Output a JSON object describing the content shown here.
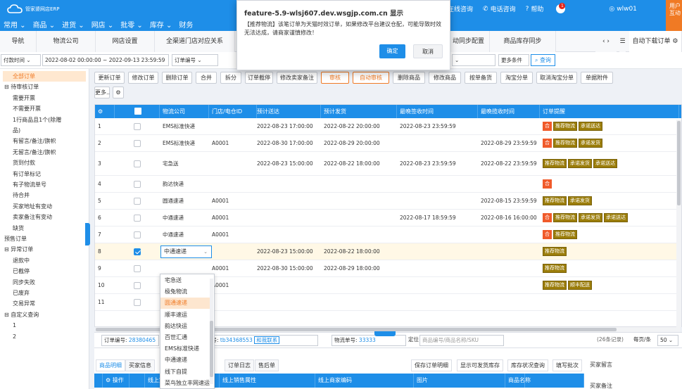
{
  "app": {
    "logo_text": "管家婆网店ERP",
    "corner_label": "用户互动",
    "user": "wlw01"
  },
  "topnav": [
    "常用",
    "商品",
    "进货",
    "网店",
    "批零",
    "库存",
    "财务"
  ],
  "rightnav": {
    "consult": "在线咨询",
    "phone": "电话咨询",
    "help": "帮助",
    "bell_count": "1"
  },
  "tabs": [
    "导航",
    "物流公司",
    "网店设置",
    "全渠道门店对应关系",
    "",
    "",
    "",
    "",
    "动同步配置",
    "商品库存同步"
  ],
  "tabs_right": "自动下载订单",
  "filter": {
    "time_type": "付款时间",
    "date_range": "2022-08-02 00:00:00 ~ 2022-09-13 23:59:59",
    "order_field": "订单编号",
    "more": "更多条件",
    "search": "查询"
  },
  "sidebar": [
    {
      "label": "全部订单",
      "level": 0
    },
    {
      "label": "⊟ 待审核订单",
      "level": 0
    },
    {
      "label": "需要开票",
      "level": 1
    },
    {
      "label": "不需要开票",
      "level": 1
    },
    {
      "label": "1行商品且1个(除赠",
      "level": 1
    },
    {
      "label": "品)",
      "level": 1
    },
    {
      "label": "有留言/备注/旗帜",
      "level": 1
    },
    {
      "label": "无留言/备注/旗帜",
      "level": 1
    },
    {
      "label": "货到付款",
      "level": 1
    },
    {
      "label": "有订单标记",
      "level": 1
    },
    {
      "label": "有子物流单号",
      "level": 1
    },
    {
      "label": "待合并",
      "level": 1
    },
    {
      "label": "买家地址有变动",
      "level": 1
    },
    {
      "label": "卖家备注有变动",
      "level": 1
    },
    {
      "label": "缺货",
      "level": 1
    },
    {
      "label": "预售订单",
      "level": 0
    },
    {
      "label": "⊟ 异常订单",
      "level": 0
    },
    {
      "label": "退款中",
      "level": 1
    },
    {
      "label": "已截停",
      "level": 1
    },
    {
      "label": "同步失败",
      "level": 1
    },
    {
      "label": "已废弃",
      "level": 1
    },
    {
      "label": "交易异常",
      "level": 1
    },
    {
      "label": "⊟ 自定义查询",
      "level": 0
    },
    {
      "label": "1",
      "level": 1
    },
    {
      "label": "2",
      "level": 1
    }
  ],
  "toolbar_row1": [
    "更新订单",
    "修改订单",
    "删除订单",
    "合并",
    "拆分",
    "订单截停",
    "修改卖家备注",
    "审核",
    "自动审核",
    "删除商品",
    "修改商品",
    "按单备货",
    "淘宝分单",
    "取消淘宝分单",
    "单据附件"
  ],
  "toolbar_row2": [
    "更多.."
  ],
  "grid": {
    "headers": [
      "",
      "",
      "物流公司",
      "门店/电仓ID",
      "预计送达",
      "预计发货",
      "最晚签收时间",
      "最晚揽收时间",
      "订单提醒"
    ],
    "rows": [
      {
        "no": "1",
        "checked": false,
        "carrier": "EMS标准快递",
        "store": "",
        "eta": "2022-08-23 17:00:00",
        "ship": "2022-08-22 20:00:00",
        "sign": "2022-08-23 23:59:59",
        "pickup": "",
        "tags": [
          {
            "t": "合",
            "red": true
          },
          {
            "t": "推荐物流",
            "red": false
          },
          {
            "t": "承诺送达",
            "red": false
          }
        ]
      },
      {
        "no": "2",
        "checked": false,
        "carrier": "EMS标准快递",
        "store": "A0001",
        "eta": "2022-08-30 17:00:00",
        "ship": "2022-08-29 20:00:00",
        "sign": "",
        "pickup": "2022-08-29 23:59:59",
        "tags": [
          {
            "t": "合",
            "red": true
          },
          {
            "t": "推荐物流",
            "red": false
          },
          {
            "t": "承诺发货",
            "red": false
          }
        ]
      },
      {
        "no": "3",
        "checked": false,
        "carrier": "宅急送",
        "store": "",
        "eta": "2022-08-23 15:00:00",
        "ship": "2022-08-22 18:00:00",
        "sign": "2022-08-23 23:59:59",
        "pickup": "2022-08-22 23:59:59",
        "tags": [
          {
            "t": "推荐物流",
            "red": false
          },
          {
            "t": "承诺发货",
            "red": false
          },
          {
            "t": "承诺送达",
            "red": false
          }
        ]
      },
      {
        "no": "4",
        "checked": false,
        "carrier": "韵达快递",
        "store": "",
        "eta": "",
        "ship": "",
        "sign": "",
        "pickup": "",
        "tags": [
          {
            "t": "合",
            "red": true
          }
        ]
      },
      {
        "no": "5",
        "checked": false,
        "carrier": "圆通速递",
        "store": "A0001",
        "eta": "",
        "ship": "",
        "sign": "",
        "pickup": "2022-08-15 23:59:59",
        "tags": [
          {
            "t": "推荐物流",
            "red": false
          },
          {
            "t": "承诺发货",
            "red": false
          }
        ]
      },
      {
        "no": "6",
        "checked": false,
        "carrier": "中通速递",
        "store": "A0001",
        "eta": "",
        "ship": "",
        "sign": "2022-08-17 18:59:59",
        "pickup": "2022-08-16 16:00:00",
        "tags": [
          {
            "t": "合",
            "red": true
          },
          {
            "t": "推荐物流",
            "red": false
          },
          {
            "t": "承诺发货",
            "red": false
          },
          {
            "t": "承诺送达",
            "red": false
          }
        ]
      },
      {
        "no": "7",
        "checked": false,
        "carrier": "中通速递",
        "store": "A0001",
        "eta": "",
        "ship": "",
        "sign": "",
        "pickup": "",
        "tags": [
          {
            "t": "合",
            "red": true
          },
          {
            "t": "推荐物流",
            "red": false
          }
        ]
      },
      {
        "no": "8",
        "checked": true,
        "carrier": "中通速递",
        "store": "",
        "eta": "2022-08-23 15:00:00",
        "ship": "2022-08-22 18:00:00",
        "sign": "",
        "pickup": "",
        "tags": [
          {
            "t": "推荐物流",
            "red": false
          }
        ]
      },
      {
        "no": "9",
        "checked": false,
        "carrier": "",
        "store": "A0001",
        "eta": "2022-08-30 15:00:00",
        "ship": "2022-08-29 18:00:00",
        "sign": "",
        "pickup": "",
        "tags": [
          {
            "t": "推荐物流",
            "red": false
          }
        ]
      },
      {
        "no": "10",
        "checked": false,
        "carrier": "",
        "store": "A0001",
        "eta": "",
        "ship": "",
        "sign": "",
        "pickup": "",
        "tags": [
          {
            "t": "推荐物流",
            "red": false
          },
          {
            "t": "顺丰配送",
            "red": false
          }
        ]
      },
      {
        "no": "11",
        "checked": false,
        "carrier": "",
        "store": "",
        "eta": "",
        "ship": "",
        "sign": "",
        "pickup": "",
        "tags": []
      }
    ]
  },
  "dropdown": {
    "value": "中通速递",
    "options": [
      "宅急送",
      "极兔物流",
      "圆通速递",
      "顺丰速运",
      "韵达快运",
      "百世汇通",
      "EMS标准快递",
      "中通速递",
      "线下自提",
      "菜鸟独立丰网速运"
    ],
    "highlighted": "圆通速递"
  },
  "footer": {
    "order_no_label": "订单编号:",
    "order_no": "28380465",
    "buyer_label": "买家账号:",
    "buyer": "tb34368553",
    "contact": "和我联系",
    "logistics_label": "物流单号:",
    "logistics": "33333",
    "locate": "定位",
    "locate_placeholder": "商品编号/商品名称/SKU",
    "records": "(26条记录)",
    "per_page": "每页/条",
    "per_page_value": "50"
  },
  "bottom": {
    "tabs": [
      "商品明细",
      "买家信息",
      "",
      "",
      "订单日志",
      "售后单"
    ],
    "visible_tab_fragment": "订单日志",
    "actions": [
      "保存订单明细",
      "显示可发货库存",
      "库存状况查询",
      "填写批次"
    ],
    "buyer_msg": "买家留言",
    "buyer_note": "买家备注",
    "headers": [
      "",
      "操作",
      "",
      "线上宝贝名称",
      "线上销售属性",
      "线上商家编码",
      "图片",
      "商品名称"
    ]
  },
  "dialog": {
    "title": "feature-5.9-wlsj607.dev.wsgjp.com.cn 显示",
    "message": "【推荐物流】该笔订单为天猫时效订单，如果修改平台建议仓配，可能导致时效无法达成，请商家谨慎修改！",
    "ok": "确定",
    "cancel": "取消"
  }
}
